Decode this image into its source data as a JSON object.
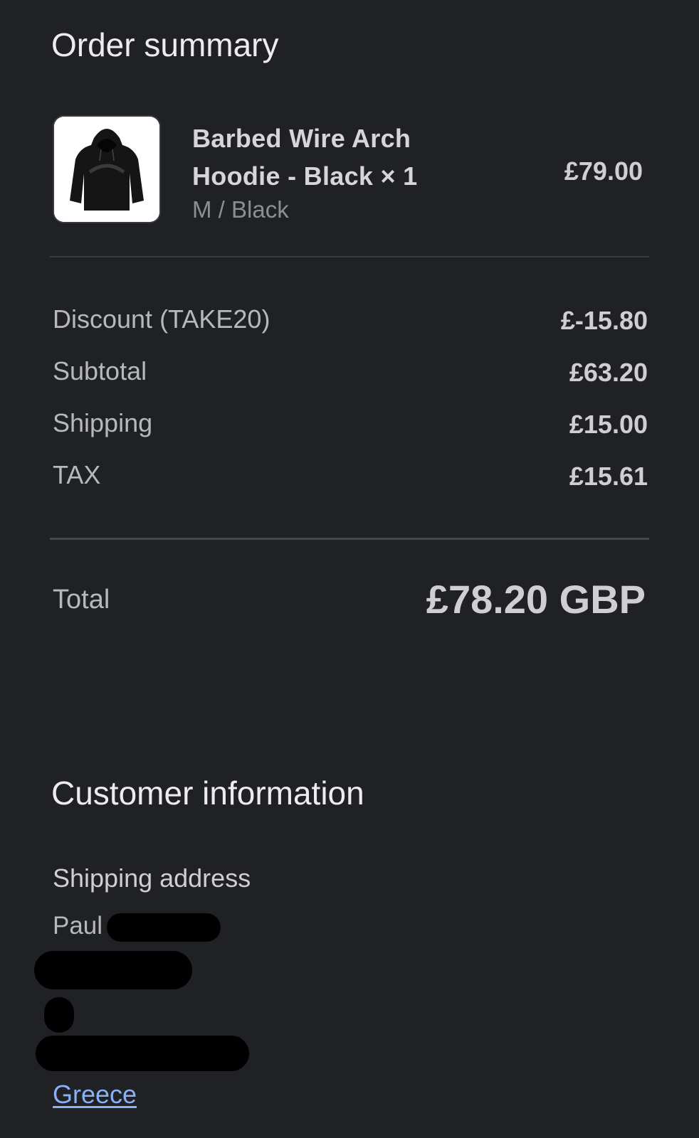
{
  "order_summary": {
    "title": "Order summary",
    "product": {
      "name": "Barbed Wire Arch Hoodie - Black × 1",
      "variant": "M / Black",
      "price": "£79.00",
      "image_icon": "hoodie-thumbnail"
    },
    "lines": [
      {
        "label": "Discount (TAKE20)",
        "value": "£-15.80"
      },
      {
        "label": "Subtotal",
        "value": "£63.20"
      },
      {
        "label": "Shipping",
        "value": "£15.00"
      },
      {
        "label": "TAX",
        "value": "£15.61"
      }
    ],
    "total": {
      "label": "Total",
      "value": "£78.20 GBP"
    }
  },
  "customer_information": {
    "title": "Customer information",
    "shipping_address": {
      "heading": "Shipping address",
      "name": "Paul",
      "country": "Greece"
    }
  },
  "colors": {
    "background": "#202125",
    "link": "#8ab0f5",
    "redaction": "#000000"
  }
}
